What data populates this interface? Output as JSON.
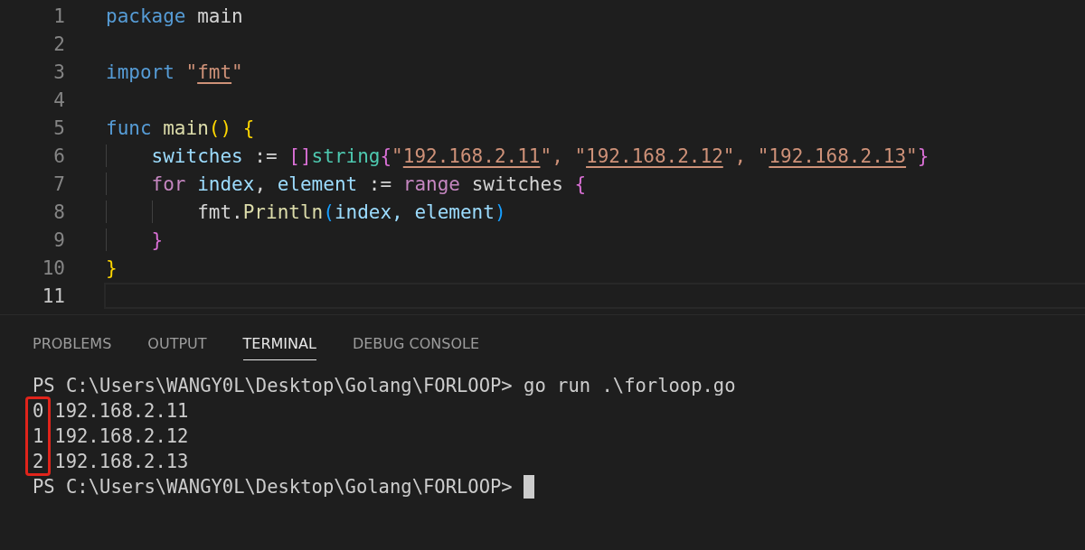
{
  "editor": {
    "lines": [
      {
        "number": "1",
        "current": false,
        "tokens": [
          {
            "text": "package",
            "kind": "keyword"
          },
          {
            "text": " main",
            "kind": "plain"
          }
        ]
      },
      {
        "number": "2",
        "current": false
      },
      {
        "number": "3",
        "current": false,
        "tokens": [
          {
            "text": "import",
            "kind": "keyword"
          },
          {
            "text": " \"",
            "kind": "string"
          },
          {
            "text": "fmt",
            "kind": "link"
          },
          {
            "text": "\"",
            "kind": "string"
          }
        ]
      },
      {
        "number": "4",
        "current": false
      },
      {
        "number": "5",
        "current": false,
        "tokens": [
          {
            "text": "func",
            "kind": "keyword"
          },
          {
            "text": " main",
            "kind": "func"
          },
          {
            "text": "()",
            "kind": "brace1"
          },
          {
            "text": " {",
            "kind": "brace1"
          }
        ]
      },
      {
        "number": "6",
        "current": false,
        "tokens": [
          {
            "text": "    switches",
            "kind": "var"
          },
          {
            "text": " := ",
            "kind": "plain"
          },
          {
            "text": "[]",
            "kind": "brace2"
          },
          {
            "text": "string",
            "kind": "type"
          },
          {
            "text": "{",
            "kind": "brace2"
          },
          {
            "text": "\"",
            "kind": "string"
          },
          {
            "text": "192.168.2.11",
            "kind": "link"
          },
          {
            "text": "\", \"",
            "kind": "string"
          },
          {
            "text": "192.168.2.12",
            "kind": "link"
          },
          {
            "text": "\", \"",
            "kind": "string"
          },
          {
            "text": "192.168.2.13",
            "kind": "link"
          },
          {
            "text": "\"",
            "kind": "string"
          },
          {
            "text": "}",
            "kind": "brace2"
          }
        ]
      },
      {
        "number": "7",
        "current": false,
        "tokens": [
          {
            "text": "    for",
            "kind": "control"
          },
          {
            "text": " index",
            "kind": "var"
          },
          {
            "text": ", ",
            "kind": "plain"
          },
          {
            "text": "element",
            "kind": "var"
          },
          {
            "text": " := ",
            "kind": "plain"
          },
          {
            "text": "range",
            "kind": "control"
          },
          {
            "text": " switches ",
            "kind": "plain"
          },
          {
            "text": "{",
            "kind": "brace2"
          }
        ]
      },
      {
        "number": "8",
        "current": false,
        "tokens": [
          {
            "text": "        fmt.",
            "kind": "plain"
          },
          {
            "text": "Println",
            "kind": "func"
          },
          {
            "text": "(",
            "kind": "brace3"
          },
          {
            "text": "index, element",
            "kind": "var"
          },
          {
            "text": ")",
            "kind": "brace3"
          }
        ]
      },
      {
        "number": "9",
        "current": false,
        "tokens": [
          {
            "text": "    }",
            "kind": "brace2"
          }
        ]
      },
      {
        "number": "10",
        "current": false,
        "tokens": [
          {
            "text": "}",
            "kind": "brace1"
          }
        ]
      },
      {
        "number": "11",
        "current": true
      }
    ]
  },
  "panel": {
    "tabs": [
      {
        "label": "PROBLEMS",
        "selected": false
      },
      {
        "label": "OUTPUT",
        "selected": false
      },
      {
        "label": "TERMINAL",
        "selected": true
      },
      {
        "label": "DEBUG CONSOLE",
        "selected": false
      }
    ],
    "terminal": {
      "command_line": "PS C:\\Users\\WANGY0L\\Desktop\\Golang\\FORLOOP> go run .\\forloop.go",
      "results": [
        {
          "index": "0",
          "value": "192.168.2.11"
        },
        {
          "index": "1",
          "value": "192.168.2.12"
        },
        {
          "index": "2",
          "value": "192.168.2.13"
        }
      ],
      "index_highlight": true,
      "prompt": "PS C:\\Users\\WANGY0L\\Desktop\\Golang\\FORLOOP>"
    }
  }
}
